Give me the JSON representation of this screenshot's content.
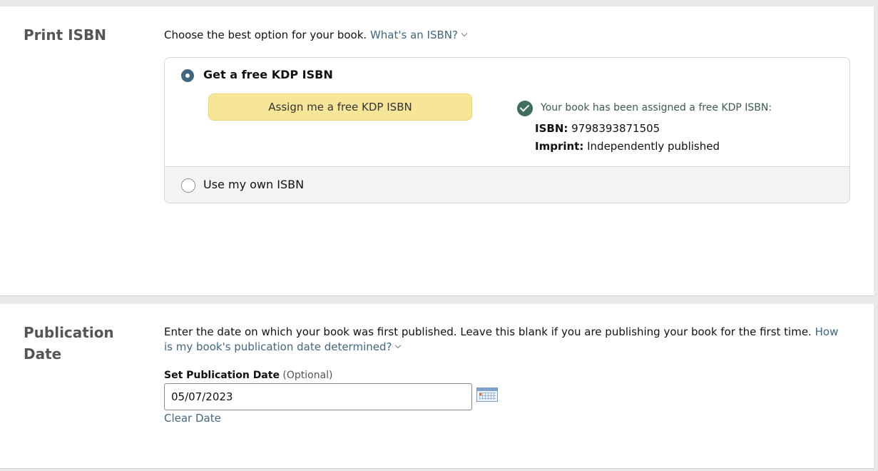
{
  "print_isbn": {
    "title": "Print ISBN",
    "description": "Choose the best option for your book.",
    "help_link": "What's an ISBN?",
    "option_free": {
      "label": "Get a free KDP ISBN",
      "selected": true,
      "button_label": "Assign me a free KDP ISBN",
      "assigned_message": "Your book has been assigned a free KDP ISBN:",
      "isbn_label": "ISBN:",
      "isbn_value": "9798393871505",
      "imprint_label": "Imprint:",
      "imprint_value": "Independently published"
    },
    "option_own": {
      "label": "Use my own ISBN",
      "selected": false
    }
  },
  "publication_date": {
    "title_line1": "Publication",
    "title_line2": "Date",
    "description": "Enter the date on which your book was first published. Leave this blank if you are publishing your book for the first time.",
    "help_link": "How is my book's publication date determined?",
    "field_label": "Set Publication Date",
    "field_optional": "(Optional)",
    "field_value": "05/07/2023",
    "calendar_icon": "calendar-icon",
    "clear_link": "Clear Date"
  },
  "colors": {
    "accent": "#41677f",
    "button_yellow": "#f7e698",
    "success": "#3f6e5f"
  }
}
